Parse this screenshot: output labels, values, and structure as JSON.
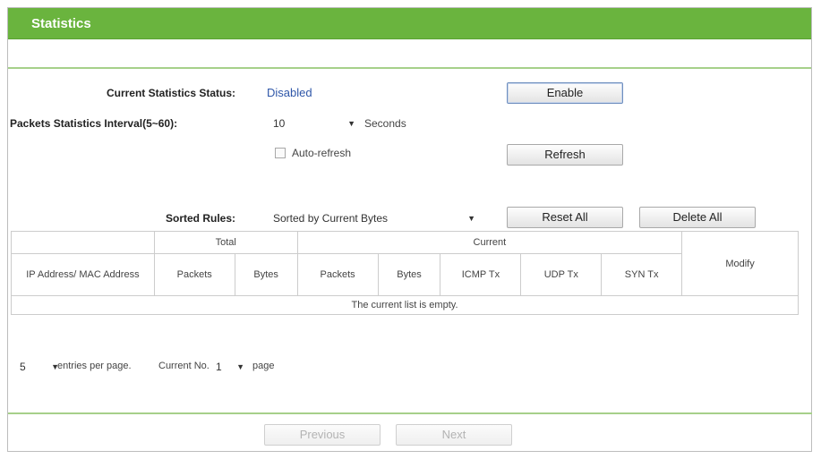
{
  "page": {
    "title": "Statistics"
  },
  "status": {
    "label": "Current Statistics Status:",
    "value": "Disabled",
    "enable_button": "Enable"
  },
  "interval": {
    "label": "Packets Statistics Interval(5~60):",
    "value": "10",
    "unit": "Seconds"
  },
  "auto_refresh": {
    "label": "Auto-refresh",
    "checked": false
  },
  "refresh_button": "Refresh",
  "sort": {
    "label": "Sorted Rules:",
    "value": "Sorted by Current Bytes"
  },
  "reset_button": "Reset All",
  "delete_button": "Delete All",
  "table": {
    "group_total": "Total",
    "group_current": "Current",
    "col_ip": "IP Address/ MAC Address",
    "col_packets": "Packets",
    "col_bytes": "Bytes",
    "col_cur_packets": "Packets",
    "col_cur_bytes": "Bytes",
    "col_icmp": "ICMP Tx",
    "col_udp": "UDP Tx",
    "col_syn": "SYN Tx",
    "col_modify": "Modify",
    "empty_message": "The current list is empty."
  },
  "pagination": {
    "entries_value": "5",
    "entries_text": "entries per page.",
    "current_label": "Current No.",
    "page_value": "1",
    "page_text": "page",
    "previous_button": "Previous",
    "next_button": "Next"
  },
  "icons": {
    "dropdown": "triangle-down"
  },
  "colors": {
    "title_bar": "#6ab43e",
    "status": "#2e56a8",
    "divider": "#a6d08a"
  }
}
